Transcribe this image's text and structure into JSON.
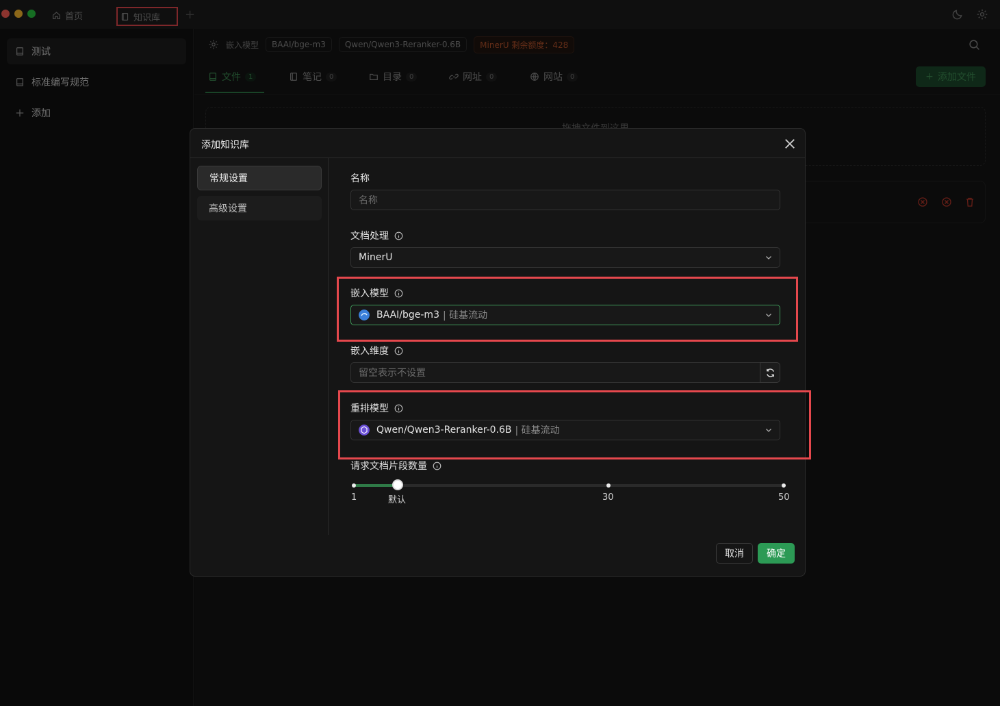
{
  "titlebar": {
    "home_tab": "首页",
    "kb_tab": "知识库"
  },
  "sidebar": {
    "items": [
      {
        "label": "测试"
      },
      {
        "label": "标准编写规范"
      }
    ],
    "add_label": "添加"
  },
  "topbar": {
    "embed_label": "嵌入模型",
    "embed_chip": "BAAI/bge-m3",
    "rerank_chip": "Qwen/Qwen3-Reranker-0.6B",
    "mineru_chip": "MinerU 剩余额度：428"
  },
  "file_tabs": [
    {
      "label": "文件",
      "count": "1"
    },
    {
      "label": "笔记",
      "count": "0"
    },
    {
      "label": "目录",
      "count": "0"
    },
    {
      "label": "网址",
      "count": "0"
    },
    {
      "label": "网站",
      "count": "0"
    }
  ],
  "add_file_button": "添加文件",
  "dropzone_text": "拖拽文件到这里",
  "modal": {
    "title": "添加知识库",
    "nav": [
      {
        "label": "常规设置"
      },
      {
        "label": "高级设置"
      }
    ],
    "fields": {
      "name_label": "名称",
      "name_placeholder": "名称",
      "doc_processing_label": "文档处理",
      "doc_processing_value": "MinerU",
      "embed_model_label": "嵌入模型",
      "embed_model_value": "BAAI/bge-m3",
      "embed_model_provider": "| 硅基流动",
      "embed_dim_label": "嵌入维度",
      "embed_dim_placeholder": "留空表示不设置",
      "rerank_model_label": "重排模型",
      "rerank_model_value": "Qwen/Qwen3-Reranker-0.6B",
      "rerank_model_provider": "| 硅基流动",
      "chunk_count_label": "请求文档片段数量"
    },
    "slider": {
      "min": 1,
      "max": 50,
      "value": 6,
      "marks": [
        "1",
        "默认",
        "30",
        "50"
      ]
    },
    "cancel_label": "取消",
    "ok_label": "确定"
  },
  "colors": {
    "accent": "#2c9a55",
    "highlight": "#e5484d"
  }
}
